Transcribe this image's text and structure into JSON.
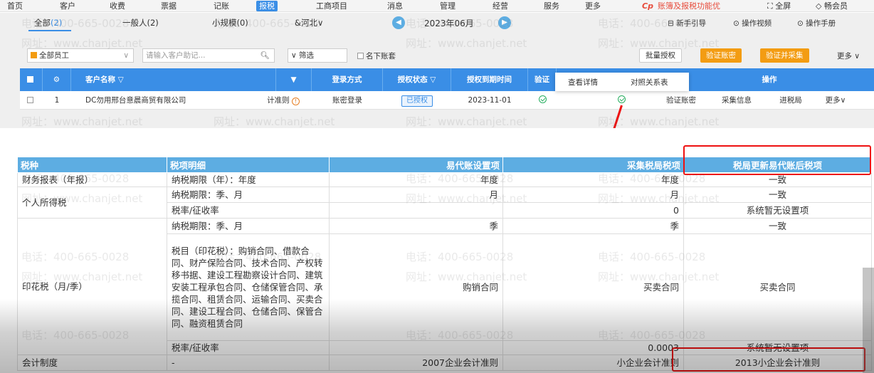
{
  "nav": {
    "items": [
      "首页",
      "客户",
      "收费",
      "票据",
      "记账",
      "报税",
      "工商项目",
      "消息",
      "管理",
      "经营",
      "服务",
      "更多"
    ],
    "active_index": 5,
    "promo_logo": "Cp",
    "promo_text": "账簿及报税功能优",
    "fullscreen": "全屏",
    "vip": "畅会员"
  },
  "tabs": {
    "items": [
      {
        "label": "全部",
        "count": "(2)"
      },
      {
        "label": "一般人(2)"
      },
      {
        "label": "小规模(0)"
      }
    ],
    "region": "&河北",
    "month": "2023年06月",
    "helpers": [
      "新手引导",
      "操作视频",
      "操作手册"
    ]
  },
  "filter": {
    "staff": "全部员工",
    "search_placeholder": "请输入客户助记...",
    "filter_label": "筛选",
    "under_label": "名下账套",
    "batch_auth": "批量授权",
    "verify_pwd": "验证账密",
    "verify_collect": "验证并采集",
    "more": "更多"
  },
  "grid": {
    "headers": [
      "客户名称",
      "",
      "登录方式",
      "授权状态",
      "授权到期时间",
      "验证",
      "操作"
    ],
    "row": {
      "index": "1",
      "name": "DC勿用邢台意晨商贸有限公司",
      "standard": "计准则",
      "login": "账密登录",
      "auth": "已授权",
      "expire": "2023-11-01",
      "actions": [
        "验证账密",
        "采集信息",
        "进税局",
        "更多"
      ]
    }
  },
  "popup": {
    "detail": "查看详情",
    "compare": "对照关系表"
  },
  "table": {
    "headers": [
      "税种",
      "税项明细",
      "易代账设置项",
      "采集税局税项",
      "税局更新易代账后税项"
    ],
    "rows": [
      {
        "tax": "财务报表（年报）",
        "item": "纳税期限（年）：年度",
        "setting": "年度",
        "collected": "年度",
        "updated": "一致"
      },
      {
        "tax": "",
        "item": "纳税期限：季、月",
        "setting": "月",
        "collected": "月",
        "updated": "一致"
      },
      {
        "tax": "个人所得税",
        "item": "税率/征收率",
        "setting": "",
        "collected": "0",
        "updated": "系统暂无设置项"
      },
      {
        "tax": "",
        "item": "纳税期限：季、月",
        "setting": "季",
        "collected": "季",
        "updated": "一致"
      },
      {
        "tax": "印花税（月/季）",
        "item": "税目（印花税）：购销合同、借款合同、财产保险合同、技术合同、产权转移书据、建设工程勘察设计合同、建筑安装工程承包合同、仓储保管合同、承揽合同、租赁合同、运输合同、买卖合同、建设工程合同、仓储合同、保管合同、融资租赁合同",
        "setting": "购销合同",
        "collected": "买卖合同",
        "updated": "买卖合同"
      },
      {
        "tax": "",
        "item": "税率/征收率",
        "setting": "",
        "collected": "0.0003",
        "updated": "系统暂无设置项"
      },
      {
        "tax": "会计制度",
        "item": "-",
        "setting": "2007企业会计准则",
        "collected": "小企业会计准则",
        "updated": "2013小企业会计准则"
      }
    ]
  },
  "watermark": {
    "phone": "电话：400-665-0028",
    "site": "网址：www.chanjet.net"
  }
}
